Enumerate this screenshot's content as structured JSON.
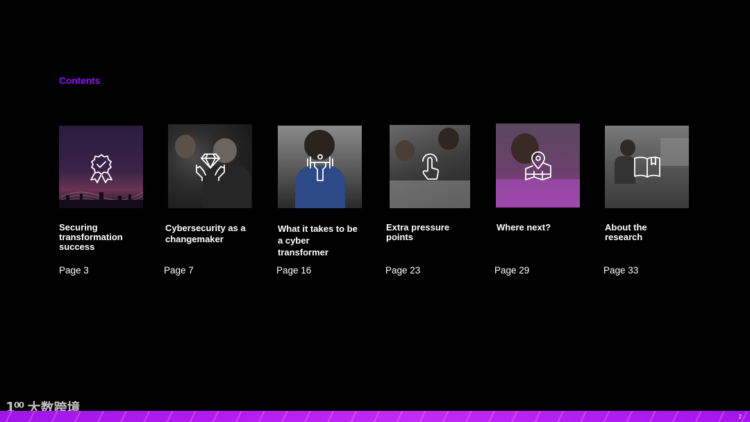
{
  "heading": "Contents",
  "accent_color": "#8f12f2",
  "items": [
    {
      "title": "Securing transformation success",
      "page": "Page 3",
      "icon": "award-ribbon-icon"
    },
    {
      "title": "Cybersecurity as a changemaker",
      "page": "Page 7",
      "icon": "hands-diamond-icon"
    },
    {
      "title": "What it takes to be a cyber transformer",
      "page": "Page 16",
      "icon": "dumbbell-lift-icon"
    },
    {
      "title": "Extra pressure points",
      "page": "Page 23",
      "icon": "pointer-hand-icon"
    },
    {
      "title": "Where next?",
      "page": "Page 29",
      "icon": "map-pin-icon"
    },
    {
      "title": "About the research",
      "page": "Page 33",
      "icon": "open-book-icon"
    }
  ],
  "slide_number": "2",
  "watermark": {
    "logo": "1⁰⁰",
    "name": "大数跨境"
  }
}
